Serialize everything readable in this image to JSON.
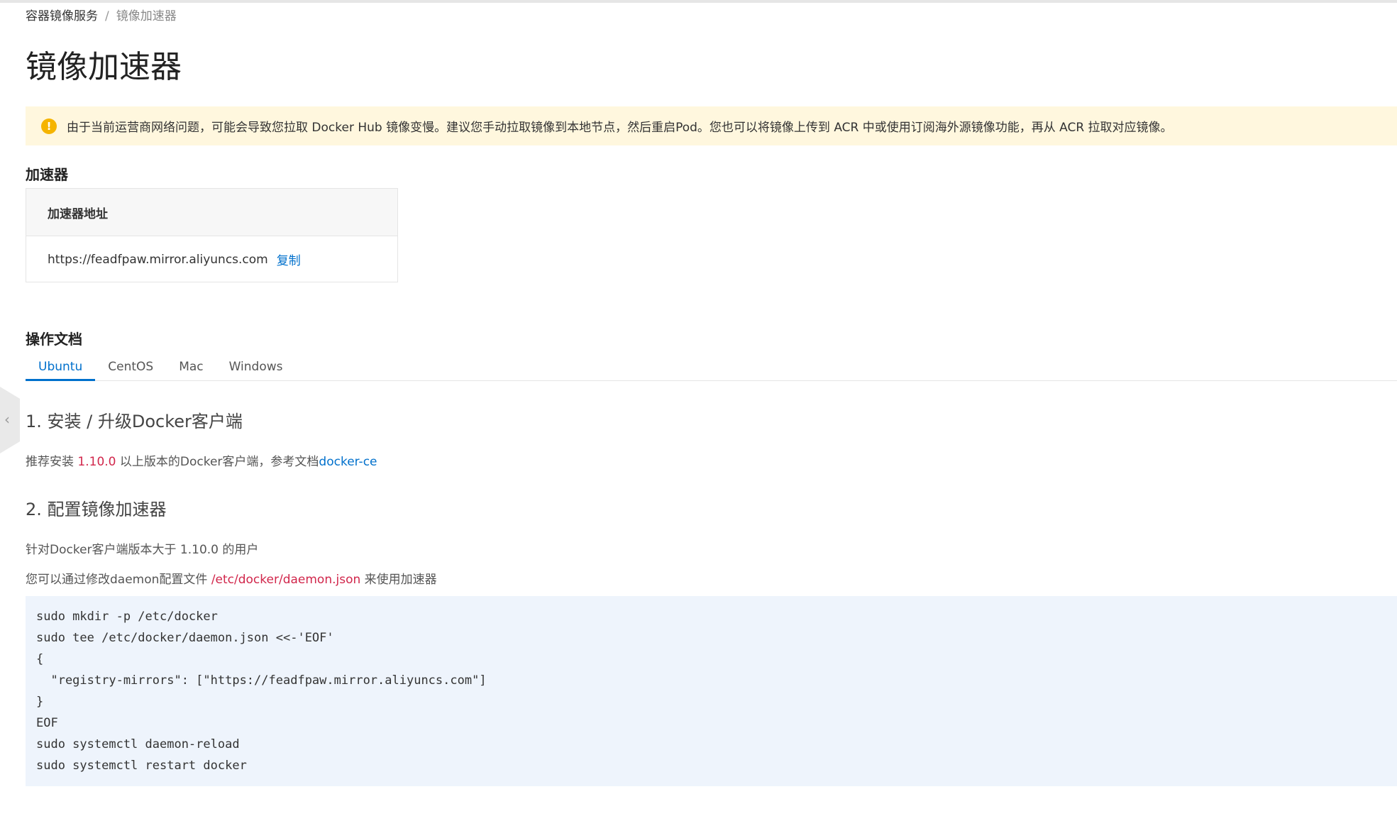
{
  "breadcrumb": {
    "parent": "容器镜像服务",
    "separator": "/",
    "current": "镜像加速器"
  },
  "page_title": "镜像加速器",
  "notice": {
    "icon": "warning-icon",
    "icon_glyph": "!",
    "color": "#f5b400",
    "text": "由于当前运营商网络问题，可能会导致您拉取 Docker Hub 镜像变慢。建议您手动拉取镜像到本地节点，然后重启Pod。您也可以将镜像上传到 ACR 中或使用订阅海外源镜像功能，再从 ACR 拉取对应镜像。"
  },
  "accelerator": {
    "section_title": "加速器",
    "column_header": "加速器地址",
    "address": "https://feadfpaw.mirror.aliyuncs.com",
    "copy_label": "复制"
  },
  "docs": {
    "section_title": "操作文档",
    "tabs": [
      {
        "label": "Ubuntu",
        "active": true
      },
      {
        "label": "CentOS",
        "active": false
      },
      {
        "label": "Mac",
        "active": false
      },
      {
        "label": "Windows",
        "active": false
      }
    ],
    "step1": {
      "title": "1. 安装 / 升级Docker客户端",
      "text_before": "推荐安装 ",
      "version": "1.10.0",
      "text_middle": " 以上版本的Docker客户端，参考文档",
      "link": "docker-ce"
    },
    "step2": {
      "title": "2. 配置镜像加速器",
      "line1": "针对Docker客户端版本大于 1.10.0 的用户",
      "line2_before": "您可以通过修改daemon配置文件 ",
      "line2_path": "/etc/docker/daemon.json",
      "line2_after": " 来使用加速器",
      "code": "sudo mkdir -p /etc/docker\nsudo tee /etc/docker/daemon.json <<-'EOF'\n{\n  \"registry-mirrors\": [\"https://feadfpaw.mirror.aliyuncs.com\"]\n}\nEOF\nsudo systemctl daemon-reload\nsudo systemctl restart docker"
    }
  },
  "colors": {
    "accent": "#0070cc",
    "highlight": "#d1264b",
    "notice_bg": "#fff7de",
    "code_bg": "#eef4fc"
  },
  "side_toggle": {
    "icon": "chevron-left-icon",
    "glyph": "‹"
  }
}
